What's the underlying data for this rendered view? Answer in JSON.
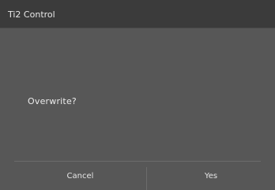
{
  "window": {
    "title": "Ti2 Control"
  },
  "dialog": {
    "message": "Overwrite?",
    "buttons": {
      "cancel_label": "Cancel",
      "yes_label": "Yes"
    }
  },
  "colors": {
    "titlebar": "#3b3b3b",
    "dialog_background": "#575757",
    "text": "#e8e8e8",
    "divider": "#6c6c6c"
  }
}
